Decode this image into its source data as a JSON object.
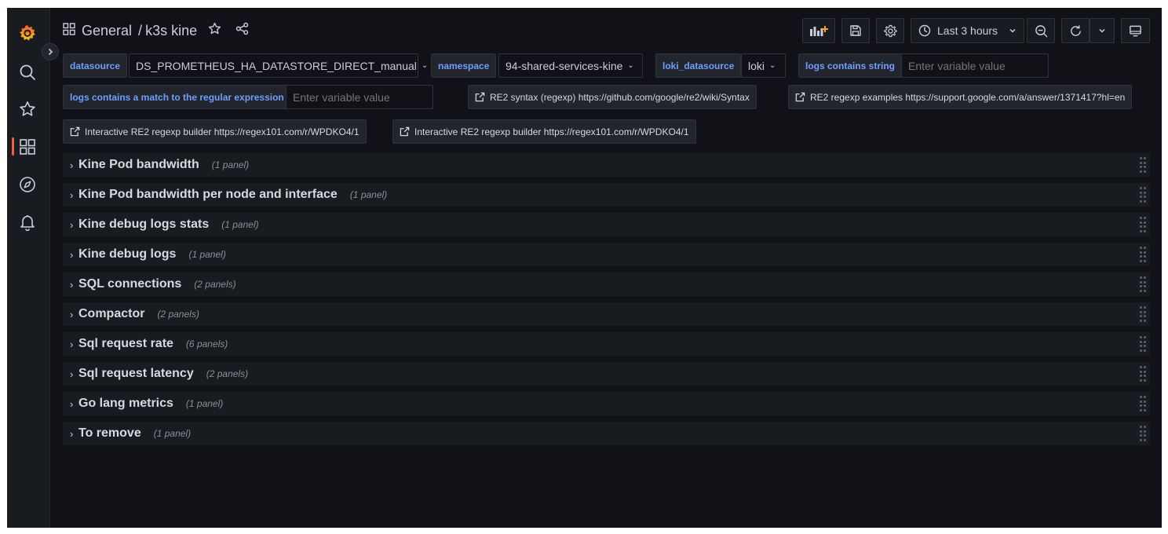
{
  "breadcrumb": {
    "folder": "General",
    "separator": "/",
    "dashboard": "k3s kine"
  },
  "toolbar": {
    "time_range": "Last 3 hours"
  },
  "variables": {
    "datasource": {
      "label": "datasource",
      "value": "DS_PROMETHEUS_HA_DATASTORE_DIRECT_manual"
    },
    "namespace": {
      "label": "namespace",
      "value": "94-shared-services-kine"
    },
    "loki_datasource": {
      "label": "loki_datasource",
      "value": "loki"
    },
    "logs_contains": {
      "label": "logs contains string",
      "placeholder": "Enter variable value"
    },
    "logs_regex": {
      "label": "logs contains a match to the regular expression",
      "placeholder": "Enter variable value"
    }
  },
  "links": [
    {
      "label": "RE2 syntax (regexp) https://github.com/google/re2/wiki/Syntax"
    },
    {
      "label": "RE2 regexp examples https://support.google.com/a/answer/1371417?hl=en"
    },
    {
      "label": "Interactive RE2 regexp builder https://regex101.com/r/WPDKO4/1"
    },
    {
      "label": "Interactive RE2 regexp builder https://regex101.com/r/WPDKO4/1"
    }
  ],
  "rows": [
    {
      "title": "Kine Pod bandwidth",
      "count": "(1 panel)"
    },
    {
      "title": "Kine Pod bandwidth per node and interface",
      "count": "(1 panel)"
    },
    {
      "title": "Kine debug logs stats",
      "count": "(1 panel)"
    },
    {
      "title": "Kine debug logs",
      "count": "(1 panel)"
    },
    {
      "title": "SQL connections",
      "count": "(2 panels)"
    },
    {
      "title": "Compactor",
      "count": "(2 panels)"
    },
    {
      "title": "Sql request rate",
      "count": "(6 panels)"
    },
    {
      "title": "Sql request latency",
      "count": "(2 panels)"
    },
    {
      "title": "Go lang metrics",
      "count": "(1 panel)"
    },
    {
      "title": "To remove",
      "count": "(1 panel)"
    }
  ],
  "icons": {
    "logo": "grafana-logo-icon",
    "search": "search-icon",
    "starred": "star-icon",
    "dashboards": "dashboards-grid-icon",
    "explore": "compass-icon",
    "alerting": "bell-icon"
  },
  "colors": {
    "accent": "#f55f3e",
    "variable_label": "#6e9fff",
    "background": "#111217",
    "panel": "#181b1f"
  }
}
